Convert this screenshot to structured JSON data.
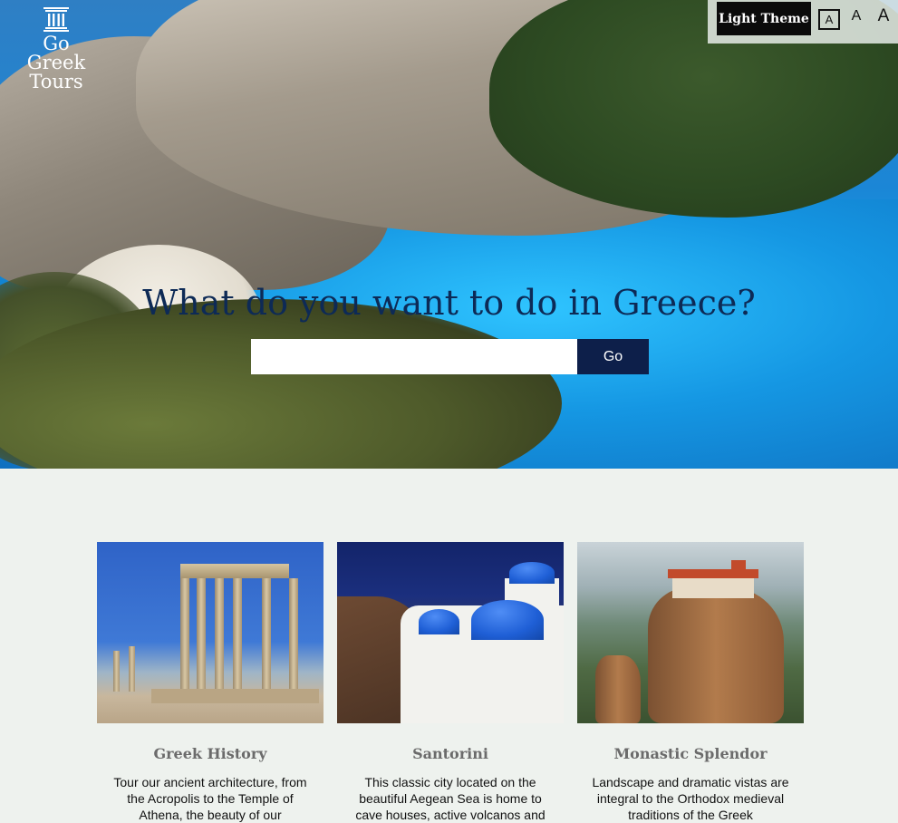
{
  "brand": {
    "name_line1": "Go Greek",
    "name_line2": "Tours",
    "logo_icon": "greek-column-icon"
  },
  "accessibility": {
    "theme_button_label": "Light Theme",
    "font_size_small": "A",
    "font_size_medium": "A",
    "font_size_large": "A"
  },
  "hero": {
    "title": "What do you want to do in Greece?",
    "search_value": "",
    "search_placeholder": "",
    "go_label": "Go"
  },
  "cards": [
    {
      "title": "Greek History",
      "text": "Tour our ancient architecture, from the Acropolis to the Temple of Athena, the beauty of our"
    },
    {
      "title": "Santorini",
      "text": "This classic city located on the beautiful Aegean Sea is home to cave houses, active volcanos and"
    },
    {
      "title": "Monastic Splendor",
      "text": "Landscape and dramatic vistas are integral to the Orthodox medieval traditions of the Greek"
    }
  ],
  "colors": {
    "title_navy": "#0d2a56",
    "go_button": "#0d1f4a",
    "page_bg": "#eef2ee"
  }
}
